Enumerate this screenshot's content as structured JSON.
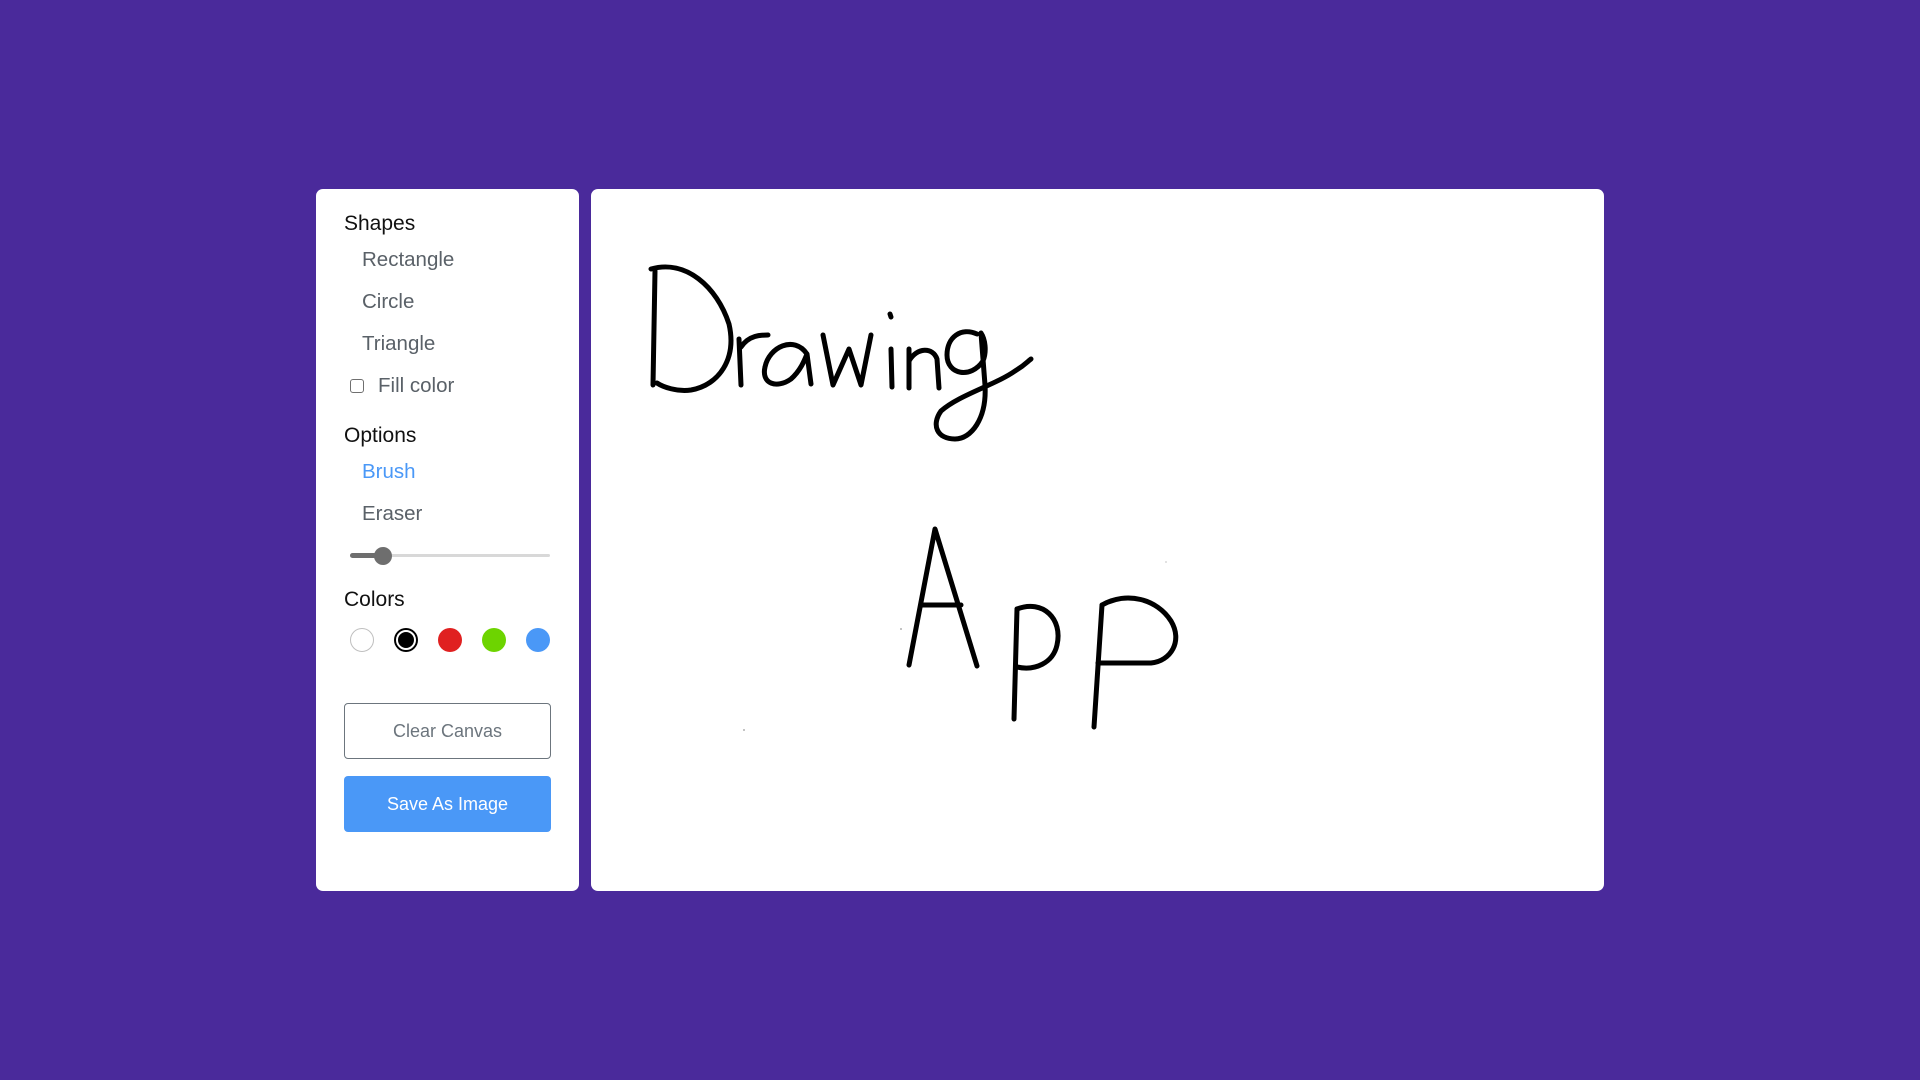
{
  "shapes": {
    "title": "Shapes",
    "items": [
      {
        "label": "Rectangle"
      },
      {
        "label": "Circle"
      },
      {
        "label": "Triangle"
      }
    ],
    "fill_color": {
      "label": "Fill color",
      "checked": false
    }
  },
  "options": {
    "title": "Options",
    "items": [
      {
        "label": "Brush",
        "active": true
      },
      {
        "label": "Eraser",
        "active": false
      }
    ],
    "size_slider": {
      "value": 0.15
    }
  },
  "colors": {
    "title": "Colors",
    "swatches": [
      {
        "name": "white",
        "hex": "#ffffff"
      },
      {
        "name": "black",
        "hex": "#000000",
        "selected": true
      },
      {
        "name": "red",
        "hex": "#E02020"
      },
      {
        "name": "green",
        "hex": "#6DD400"
      },
      {
        "name": "blue",
        "hex": "#4A98F7"
      }
    ]
  },
  "buttons": {
    "clear_label": "Clear Canvas",
    "save_label": "Save As Image"
  },
  "canvas": {
    "drawing_text": "Drawing App",
    "stroke_color": "#000000"
  },
  "theme": {
    "background": "#4A2A9B",
    "accent": "#4A98F7"
  }
}
